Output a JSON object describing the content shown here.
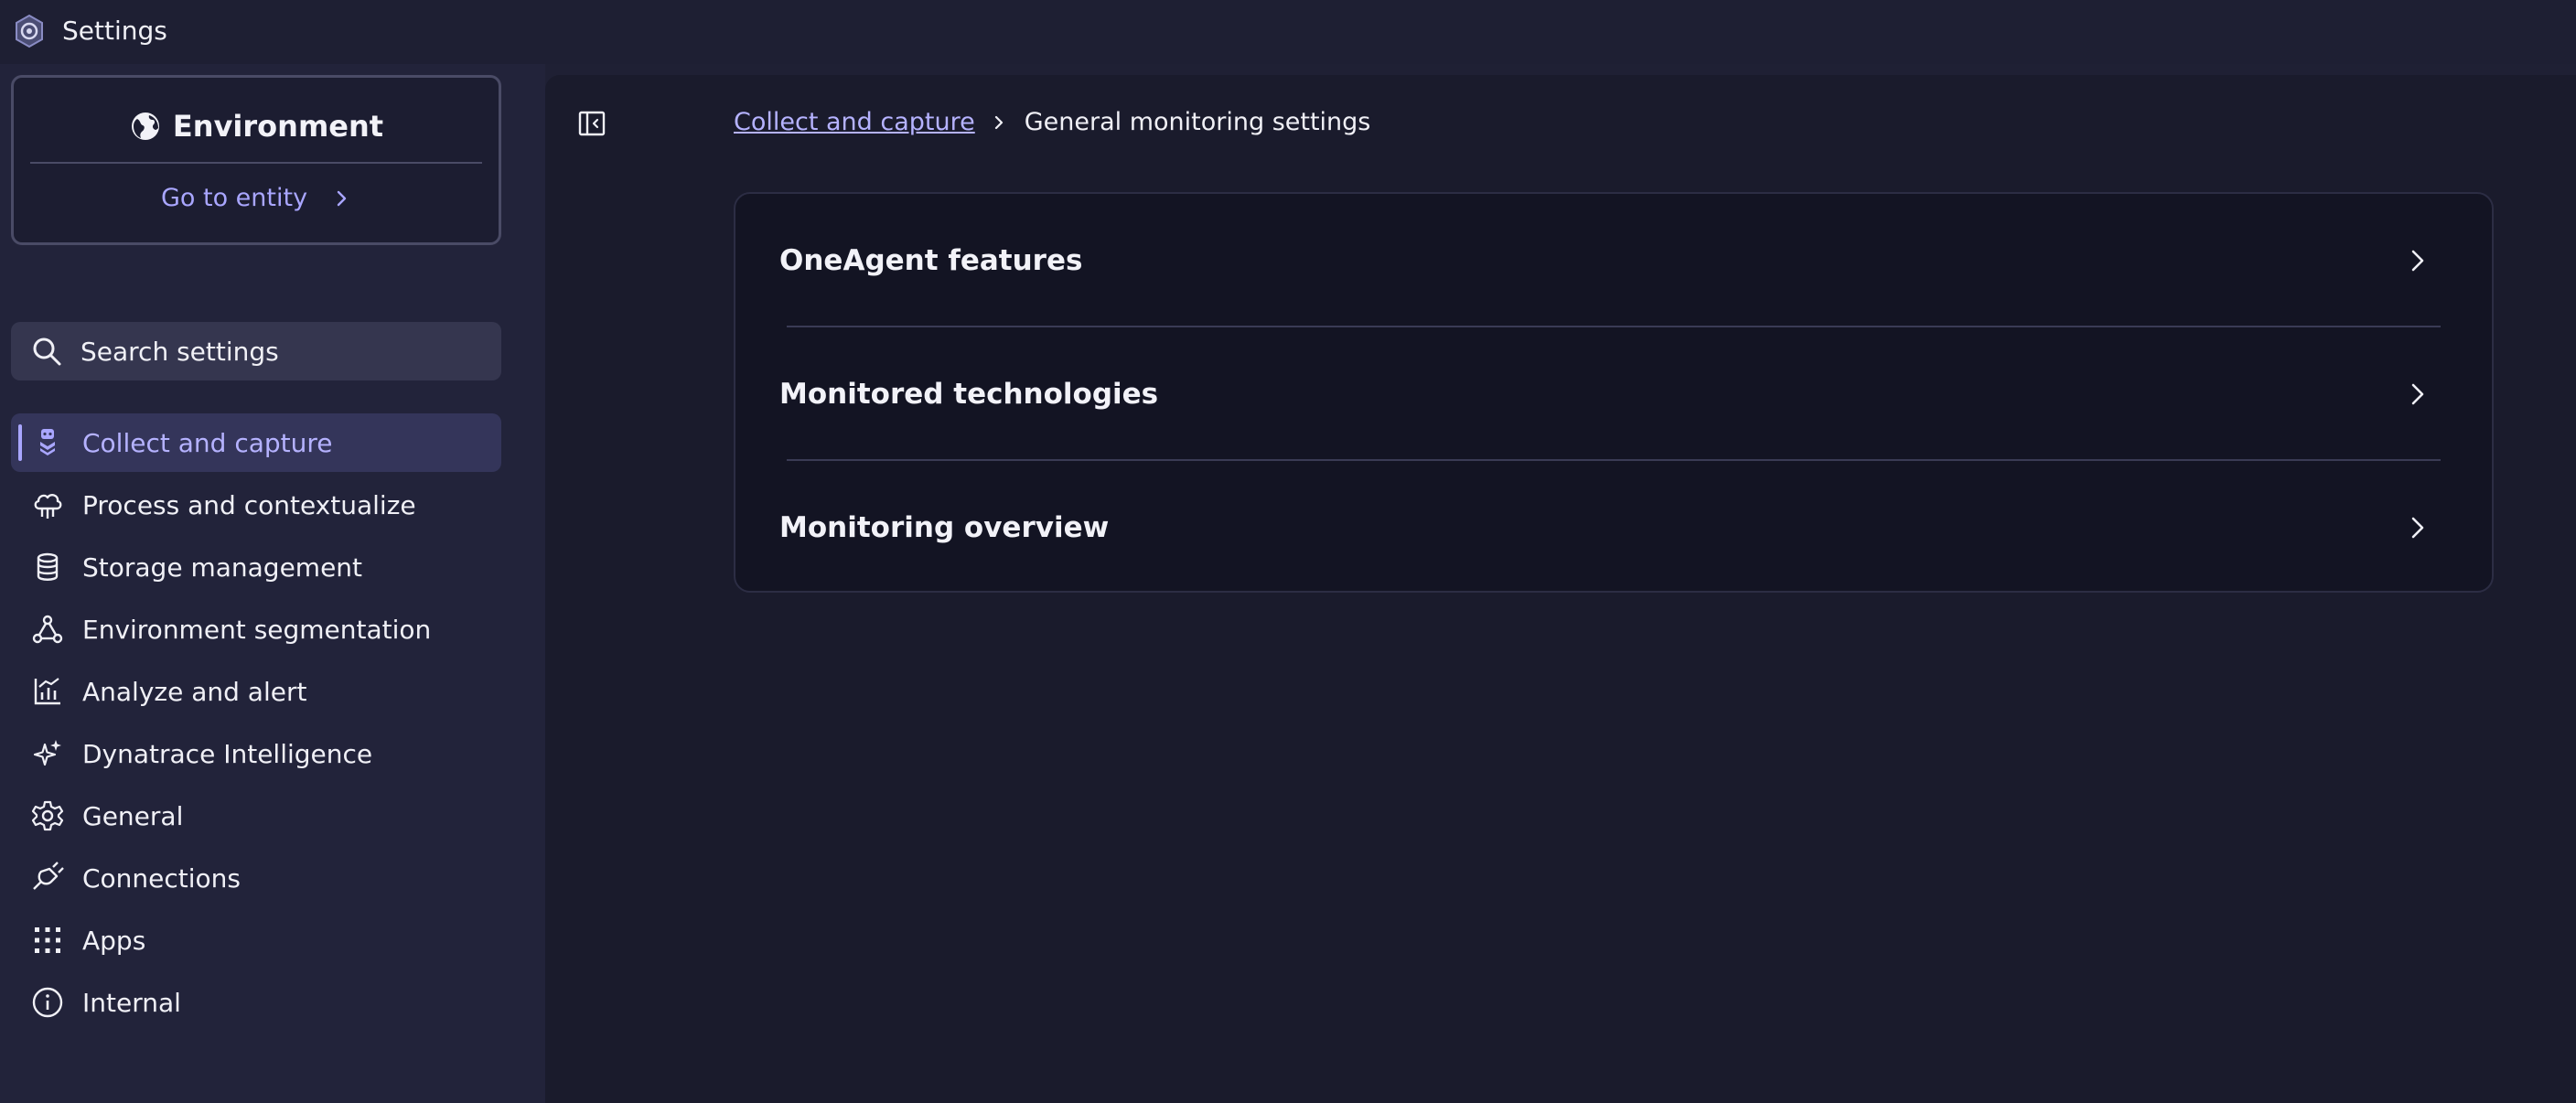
{
  "app": {
    "title": "Settings",
    "icon": "settings-gear-icon"
  },
  "environment": {
    "title": "Environment",
    "goto_label": "Go to entity"
  },
  "search": {
    "label": "Search settings"
  },
  "nav": {
    "items": [
      {
        "label": "Collect and capture",
        "icon": "collect-capture-icon",
        "active": true
      },
      {
        "label": "Process and contextualize",
        "icon": "cloud-process-icon"
      },
      {
        "label": "Storage management",
        "icon": "database-icon"
      },
      {
        "label": "Environment segmentation",
        "icon": "segmentation-icon"
      },
      {
        "label": "Analyze and alert",
        "icon": "chart-alert-icon"
      },
      {
        "label": "Dynatrace Intelligence",
        "icon": "sparkle-icon"
      },
      {
        "label": "General",
        "icon": "gear-icon"
      },
      {
        "label": "Connections",
        "icon": "plug-icon"
      },
      {
        "label": "Apps",
        "icon": "apps-grid-icon"
      },
      {
        "label": "Internal",
        "icon": "info-icon"
      }
    ]
  },
  "breadcrumb": {
    "parent": "Collect and capture",
    "current": "General monitoring settings"
  },
  "sections": [
    {
      "label": "OneAgent features"
    },
    {
      "label": "Monitored technologies"
    },
    {
      "label": "Monitoring overview"
    }
  ],
  "colors": {
    "accent": "#a9a6ff",
    "background": "#1a1b2c",
    "sidebar": "#22233a",
    "card": "#131423"
  }
}
